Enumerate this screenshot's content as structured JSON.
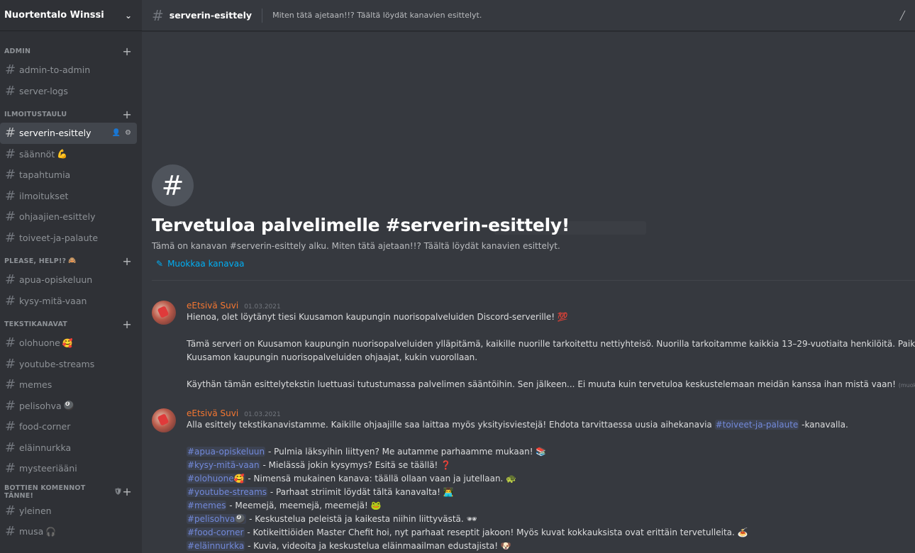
{
  "server": {
    "name": "Nuortentalo Winssi"
  },
  "sidebar": {
    "categories": [
      {
        "label": "ADMIN",
        "channels": [
          {
            "name": "admin-to-admin"
          },
          {
            "name": "server-logs"
          }
        ]
      },
      {
        "label": "ILMOITUSTAULU",
        "channels": [
          {
            "name": "serverin-esittely"
          },
          {
            "name": "säännöt",
            "emoji": "💪"
          },
          {
            "name": "tapahtumia"
          },
          {
            "name": "ilmoitukset"
          },
          {
            "name": "ohjaajien-esittely"
          },
          {
            "name": "toiveet-ja-palaute"
          }
        ]
      },
      {
        "label": "PLEASE, HELP!?",
        "label_emoji": "🙈",
        "channels": [
          {
            "name": "apua-opiskeluun"
          },
          {
            "name": "kysy-mitä-vaan"
          }
        ]
      },
      {
        "label": "TEKSTIKANAVAT",
        "channels": [
          {
            "name": "olohuone",
            "emoji": "🥰"
          },
          {
            "name": "youtube-streams"
          },
          {
            "name": "memes"
          },
          {
            "name": "pelisohva",
            "emoji": "🎱"
          },
          {
            "name": "food-corner"
          },
          {
            "name": "eläinnurkka"
          },
          {
            "name": "mysteeriääni"
          }
        ]
      },
      {
        "label": "BOTTIEN KOMENNOT TÄNNE!",
        "label_emoji": "🛡",
        "channels": [
          {
            "name": "yleinen"
          },
          {
            "name": "musa",
            "emoji": "🎧"
          }
        ]
      }
    ]
  },
  "topbar": {
    "channel": "serverin-esittely",
    "topic": "Miten tätä ajetaan!!? Täältä löydät kanavien esittelyt."
  },
  "welcome": {
    "title": "Tervetuloa palvelimelle #serverin-esittely!",
    "description": "Tämä on kanavan #serverin-esittely alku. Miten tätä ajetaan!!? Täältä löydät kanavien esittelyt.",
    "edit_label": "Muokkaa kanavaa"
  },
  "messages": [
    {
      "author": "eEtsivä Suvi",
      "date": "01.03.2021",
      "line1": "Hienoa, olet löytänyt tiesi Kuusamon kaupungin nuorisopalveluiden Discord-serverille! 💯",
      "line2": "Tämä serveri on Kuusamon kaupungin nuorisopalveluiden ylläpitämä, kaikille nuorille tarkoitettu nettiyhteisö. Nuorilla tarkoitamme kaikkia 13–29-vuotiaita henkilöitä. Paikalla päivystää",
      "line3": "Kuusamon kaupungin nuorisopalveluiden ohjaajat, kukin vuorollaan.",
      "line4": "Käythän tämän esittelytekstin luettuasi tutustumassa palvelimen sääntöihin. Sen jälkeen... Ei muuta kuin tervetuloa keskustelemaan meidän kanssa ihan mistä vaan!",
      "edited": "(muokattu)"
    },
    {
      "author": "eEtsivä Suvi",
      "date": "01.03.2021",
      "intro_a": "Alla esittely tekstikanavistamme. Kaikille ohjaajille saa laittaa myös yksityisviestejä! Ehdota tarvittaessa uusia aihekanavia ",
      "intro_mention": "#toiveet-ja-palaute",
      "intro_b": " -kanavalla.",
      "items": [
        {
          "mention": "#apua-opiskeluun",
          "text": " - Pulmia läksyihin liittyen? Me autamme parhaamme mukaan! 📚"
        },
        {
          "mention": "#kysy-mitä-vaan",
          "text": " - Mielässä jokin kysymys? Esitä se täällä! ❓"
        },
        {
          "mention": "#olohuone🥰",
          "text": " - Nimensä mukainen kanava: täällä ollaan vaan ja jutellaan. 🐢"
        },
        {
          "mention": "#youtube-streams",
          "text": " - Parhaat striimit löydät tältä kanavalta! 👨‍💻"
        },
        {
          "mention": "#memes",
          "text": " - Meemejä, meemejä, meemejä! 🐸"
        },
        {
          "mention": "#pelisohva🎱",
          "text": " - Keskustelua peleistä ja kaikesta niihin liittyvästä. 🕶"
        },
        {
          "mention": "#food-corner",
          "text": " - Kotikeittiöiden Master Chefit hoi, nyt parhaat reseptit jakoon! Myös kuvat kokkauksista ovat erittäin tervetulleita. 🍝"
        },
        {
          "mention": "#eläinnurkka",
          "text": " - Kuvia, videoita ja keskustelua eläinmaailman edustajista! 🐶"
        }
      ]
    }
  ]
}
